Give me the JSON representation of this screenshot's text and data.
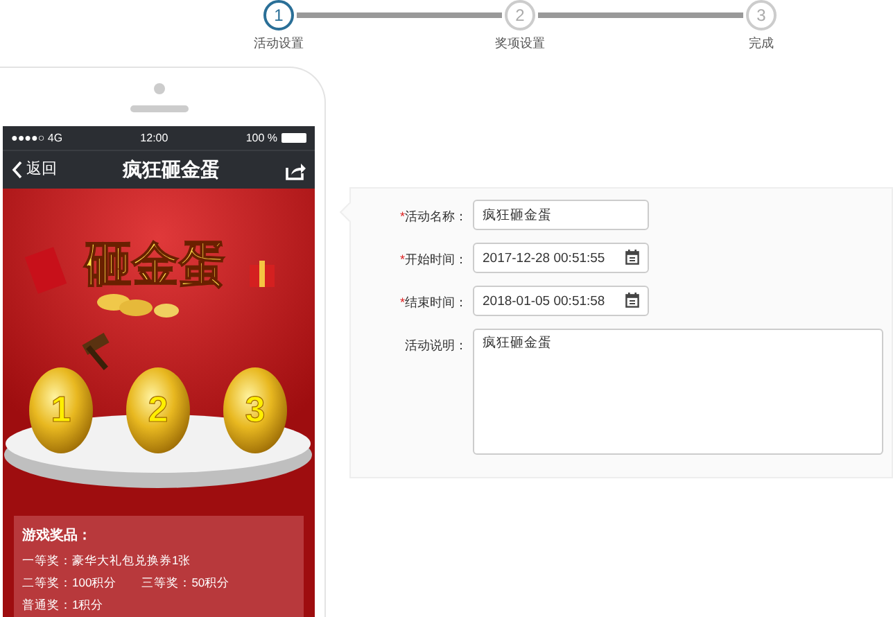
{
  "steps": [
    {
      "number": "1",
      "label": "活动设置",
      "selected": true
    },
    {
      "number": "2",
      "label": "奖项设置",
      "selected": false
    },
    {
      "number": "3",
      "label": "完成",
      "selected": false
    }
  ],
  "phone": {
    "status_bar": {
      "signal": "●●●●○ 4G",
      "time": "12:00",
      "battery": "100 %"
    },
    "nav": {
      "back": "返回",
      "title": "疯狂砸金蛋"
    },
    "banner": {
      "title": "砸金蛋",
      "eggs": [
        "1",
        "2",
        "3"
      ]
    },
    "prizes": {
      "heading": "游戏奖品：",
      "lines": [
        [
          "一等奖：豪华大礼包兑换券1张"
        ],
        [
          "二等奖：100积分",
          "三等奖：50积分"
        ],
        [
          "普通奖：1积分"
        ]
      ]
    }
  },
  "form": {
    "fields": [
      {
        "kind": "text",
        "label": "活动名称：",
        "required": true,
        "value": "疯狂砸金蛋"
      },
      {
        "kind": "datetime",
        "label": "开始时间：",
        "required": true,
        "value": "2017-12-28 00:51:55"
      },
      {
        "kind": "datetime",
        "label": "结束时间：",
        "required": true,
        "value": "2018-01-05 00:51:58"
      },
      {
        "kind": "textarea",
        "label": "活动说明：",
        "required": false,
        "value": "疯狂砸金蛋"
      }
    ],
    "required_mark": "*"
  }
}
